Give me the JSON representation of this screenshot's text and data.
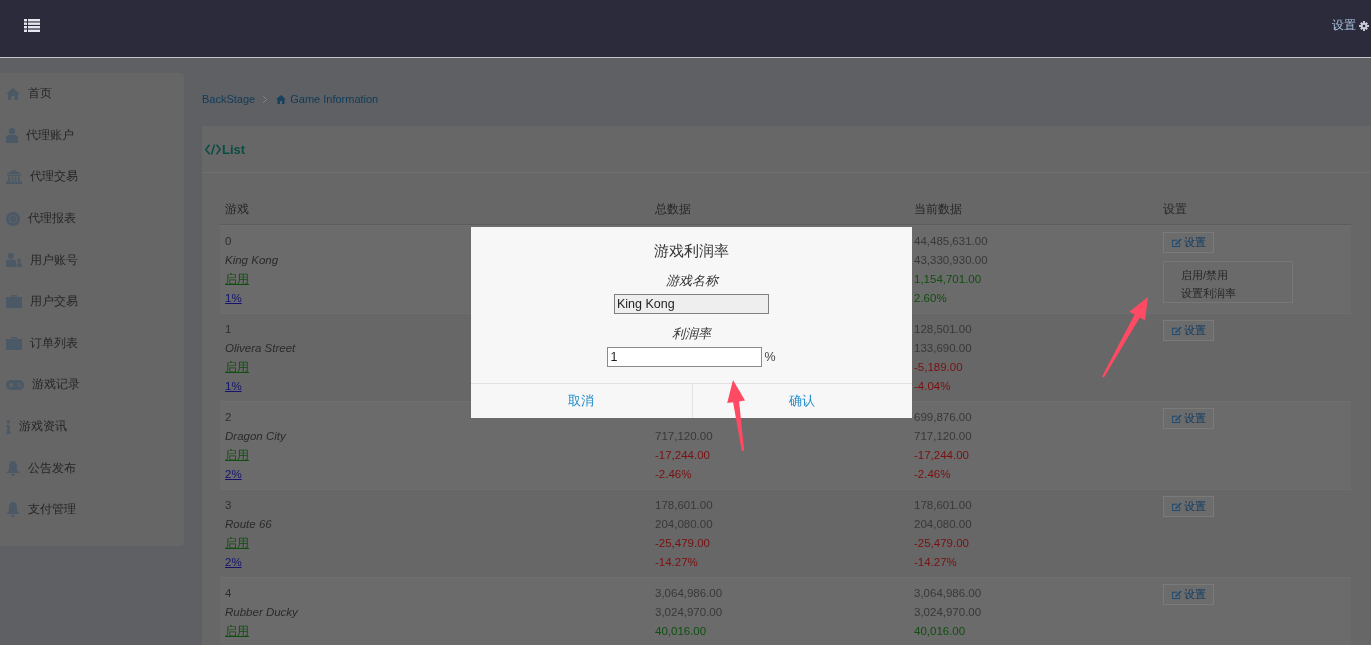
{
  "top_bar": {
    "settings_label": "设置"
  },
  "sidebar": {
    "items": [
      {
        "label": "首页"
      },
      {
        "label": "代理账户"
      },
      {
        "label": "代理交易"
      },
      {
        "label": "代理报表"
      },
      {
        "label": "用户账号"
      },
      {
        "label": "用户交易"
      },
      {
        "label": "订单列表"
      },
      {
        "label": "游戏记录"
      },
      {
        "label": "游戏资讯"
      },
      {
        "label": "公告发布"
      },
      {
        "label": "支付管理"
      }
    ]
  },
  "breadcrumb": {
    "root": "BackStage",
    "current": "Game Information"
  },
  "panel": {
    "title": "List"
  },
  "table": {
    "columns": [
      "游戏",
      "总数据",
      "当前数据",
      "设置"
    ],
    "rows": [
      {
        "id": "0",
        "name": "King Kong",
        "status": "启用",
        "rate": "1%",
        "current": {
          "value_1": "44,485,631.00",
          "value_2": "43,330,930.00",
          "value_3": "1,154,701.00",
          "value_4": "2.60%",
          "negative": false
        },
        "settings": "设置",
        "menu": [
          "启用/禁用",
          "设置利润率"
        ]
      },
      {
        "id": "1",
        "name": "Olivera Street",
        "status": "启用",
        "rate": "1%",
        "current": {
          "value_1": "128,501.00",
          "value_2": "133,690.00",
          "value_3": "-5,189.00",
          "value_4": "-4.04%",
          "negative": true
        },
        "settings": "设置"
      },
      {
        "id": "2",
        "name": "Dragon City",
        "status": "启用",
        "rate": "2%",
        "total": {
          "value_2": "717,120.00",
          "value_3": "-17,244.00",
          "value_4": "-2.46%",
          "negative": true
        },
        "current": {
          "value_1": "699,876.00",
          "value_2": "717,120.00",
          "value_3": "-17,244.00",
          "value_4": "-2.46%",
          "negative": true
        },
        "settings": "设置"
      },
      {
        "id": "3",
        "name": "Route 66",
        "status": "启用",
        "rate": "2%",
        "total": {
          "value_1": "178,601.00",
          "value_2": "204,080.00",
          "value_3": "-25,479.00",
          "value_4": "-14.27%",
          "negative": true
        },
        "current": {
          "value_1": "178,601.00",
          "value_2": "204,080.00",
          "value_3": "-25,479.00",
          "value_4": "-14.27%",
          "negative": true
        },
        "settings": "设置"
      },
      {
        "id": "4",
        "name": "Rubber Ducky",
        "status": "启用",
        "total": {
          "value_1": "3,064,986.00",
          "value_2": "3,024,970.00",
          "value_3": "40,016.00",
          "negative": false
        },
        "current": {
          "value_1": "3,064,986.00",
          "value_2": "3,024,970.00",
          "value_3": "40,016.00",
          "negative": false
        },
        "settings": "设置"
      }
    ]
  },
  "dialog": {
    "title": "游戏利润率",
    "fields": [
      {
        "label": "游戏名称",
        "value": "King Kong",
        "readonly": true
      },
      {
        "label": "利润率",
        "value": "1",
        "suffix": "%",
        "readonly": false
      }
    ],
    "buttons": [
      {
        "label": "取消"
      },
      {
        "label": "确认"
      }
    ]
  }
}
